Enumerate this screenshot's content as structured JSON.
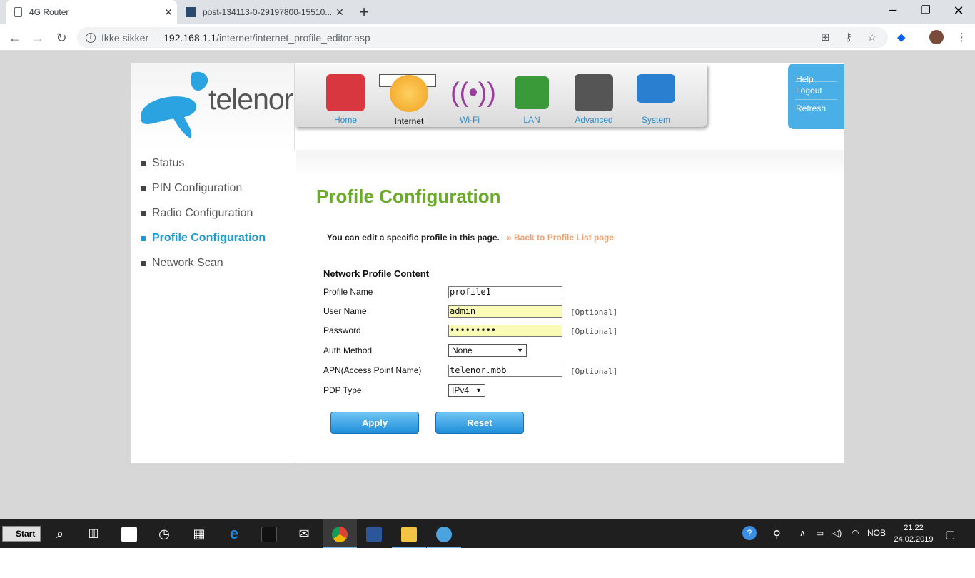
{
  "browser": {
    "tabs": [
      {
        "title": "4G Router"
      },
      {
        "title": "post-134113-0-29197800-15510..."
      }
    ],
    "address": {
      "security_label": "Ikke sikker",
      "host": "192.168.1.1",
      "path": "/internet/internet_profile_editor.asp"
    }
  },
  "router": {
    "brand": "telenor",
    "menu": [
      {
        "label": "Home",
        "icon": "home-icon",
        "color": "#d9373f"
      },
      {
        "label": "Internet",
        "icon": "globe-icon",
        "color": "#f0a020"
      },
      {
        "label": "Wi-Fi",
        "icon": "wifi-icon",
        "color": "#9b3d9e"
      },
      {
        "label": "LAN",
        "icon": "lan-icon",
        "color": "#3a9a3a"
      },
      {
        "label": "Advanced",
        "icon": "tools-icon",
        "color": "#555555"
      },
      {
        "label": "System",
        "icon": "monitor-icon",
        "color": "#2b7fd0"
      }
    ],
    "top_links": [
      "Help",
      "Logout",
      "Refresh"
    ],
    "sidebar": [
      {
        "label": "Status"
      },
      {
        "label": "PIN Configuration"
      },
      {
        "label": "Radio Configuration"
      },
      {
        "label": "Profile Configuration",
        "active": true
      },
      {
        "label": "Network Scan"
      }
    ],
    "page_title": "Profile Configuration",
    "intro": "You can edit a specific profile in this page.",
    "back_link": "» Back to Profile List page",
    "section_title": "Network Profile Content",
    "fields": {
      "profile_name": {
        "label": "Profile Name",
        "value": "profile1"
      },
      "user_name": {
        "label": "User Name",
        "value": "admin",
        "hint": "[Optional]"
      },
      "password": {
        "label": "Password",
        "value": "•••••••••",
        "hint": "[Optional]"
      },
      "auth_method": {
        "label": "Auth Method",
        "value": "None"
      },
      "apn": {
        "label": "APN(Access Point Name)",
        "value": "telenor.mbb",
        "hint": "[Optional]"
      },
      "pdp_type": {
        "label": "PDP Type",
        "value": "IPv4"
      }
    },
    "buttons": {
      "apply": "Apply",
      "reset": "Reset"
    }
  },
  "taskbar": {
    "start_label": "Start",
    "language": "NOB",
    "time": "21.22",
    "date": "24.02.2019"
  }
}
